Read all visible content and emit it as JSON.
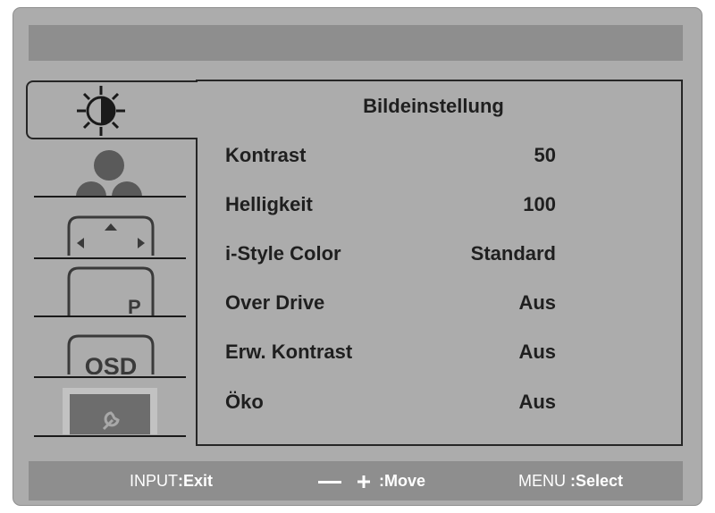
{
  "menu": {
    "title": "Bildeinstellung",
    "items": [
      {
        "label": "Kontrast",
        "value": "50"
      },
      {
        "label": "Helligkeit",
        "value": "100"
      },
      {
        "label": "i-Style Color",
        "value": "Standard"
      },
      {
        "label": "Over Drive",
        "value": "Aus"
      },
      {
        "label": "Erw. Kontrast",
        "value": "Aus"
      },
      {
        "label": "Öko",
        "value": "Aus"
      }
    ]
  },
  "tabs": [
    {
      "icon": "brightness-icon",
      "active": true
    },
    {
      "icon": "user-icon",
      "active": false
    },
    {
      "icon": "position-icon",
      "active": false
    },
    {
      "icon": "picture-mode-icon",
      "active": false,
      "text": "P"
    },
    {
      "icon": "osd-icon",
      "active": false,
      "text": "OSD"
    },
    {
      "icon": "setup-wrench-icon",
      "active": false
    }
  ],
  "footer": {
    "input_key": "INPUT",
    "input_action": ":Exit",
    "move_action": ":Move",
    "menu_key": "MENU",
    "menu_action": ":Select"
  },
  "colors": {
    "background": "#acacac",
    "bar": "#8e8e8e",
    "text": "#1f1f1f",
    "footer_text": "#ffffff"
  }
}
